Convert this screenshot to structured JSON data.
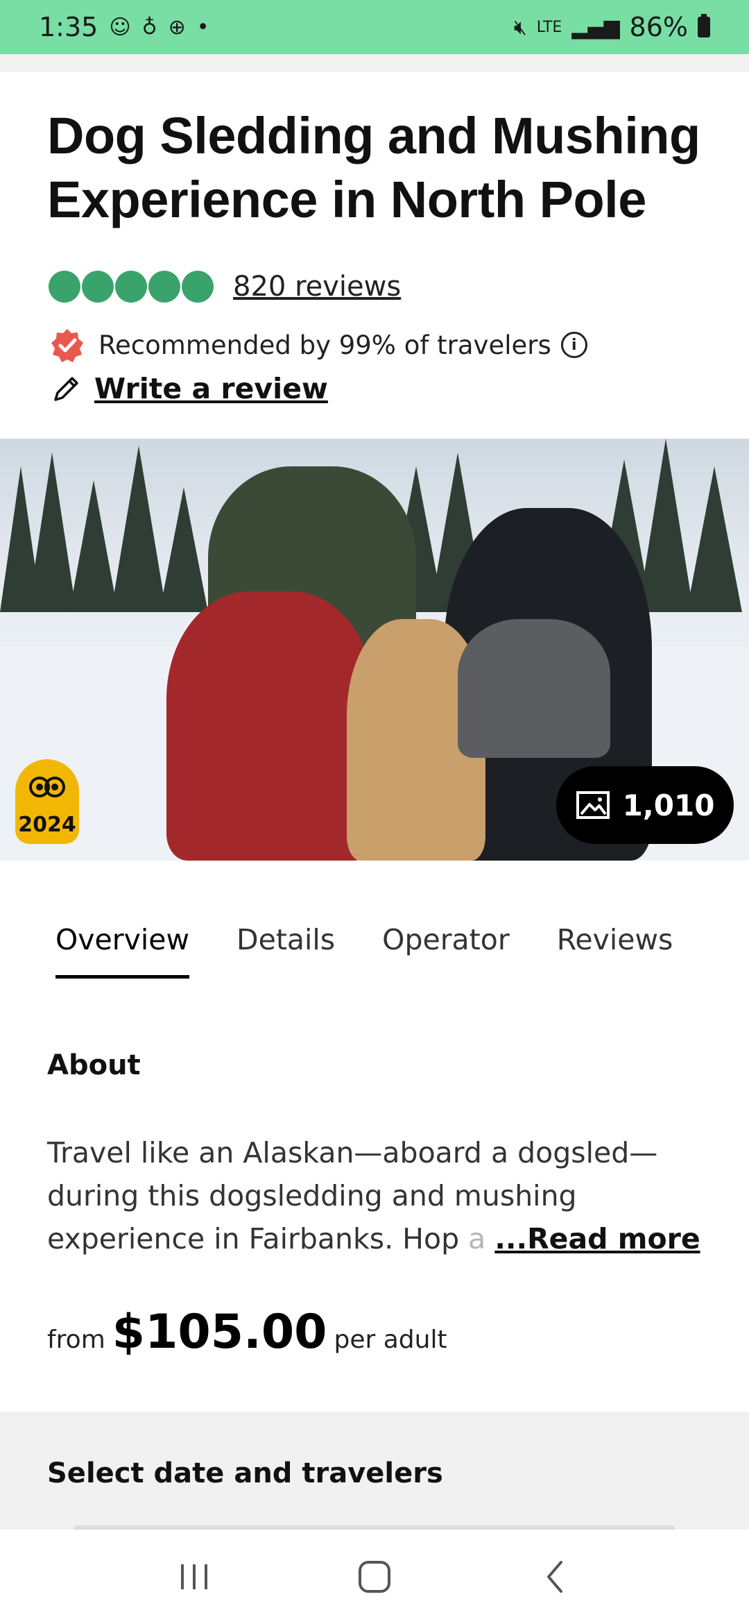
{
  "status_bar": {
    "time": "1:35",
    "network": "LTE",
    "battery": "86%"
  },
  "listing": {
    "title": "Dog Sledding and Mushing Experience in North Pole",
    "rating": 5,
    "reviews_link": "820 reviews",
    "recommended": "Recommended by 99% of travelers",
    "write_review": "Write a review",
    "award_year": "2024",
    "photo_count": "1,010"
  },
  "tabs": [
    {
      "label": "Overview",
      "active": true
    },
    {
      "label": "Details",
      "active": false
    },
    {
      "label": "Operator",
      "active": false
    },
    {
      "label": "Reviews",
      "active": false
    }
  ],
  "about": {
    "heading": "About",
    "text_visible": "Travel like an Alaskan—aboard a dogsled—during this dogsledding and mushing experience in Fairbanks. Hop",
    "text_faded": "a",
    "read_more": "...Read more"
  },
  "price": {
    "from_label": "from",
    "amount": "$105.00",
    "per_label": "per adult"
  },
  "booking": {
    "heading": "Select date and travelers"
  },
  "colors": {
    "status_bar": "#79dea4",
    "rating_bubble": "#3aa36b",
    "badge_red": "#e8584d",
    "award_yellow": "#f2b705"
  }
}
